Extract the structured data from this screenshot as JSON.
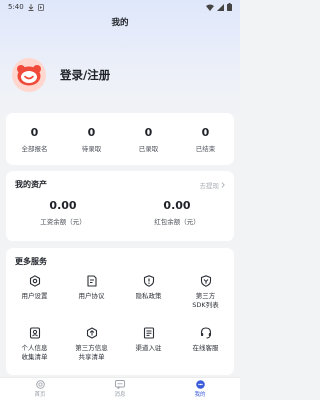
{
  "status_bar": {
    "time": "5:40"
  },
  "nav": {
    "title": "我的"
  },
  "profile": {
    "login_label": "登录/注册"
  },
  "stats": [
    {
      "value": "0",
      "label": "全部报名"
    },
    {
      "value": "0",
      "label": "待录取"
    },
    {
      "value": "0",
      "label": "已录取"
    },
    {
      "value": "0",
      "label": "已结束"
    }
  ],
  "assets": {
    "title": "我的资产",
    "withdraw_label": "去提现",
    "items": [
      {
        "value": "0.00",
        "label": "工资余额（元）"
      },
      {
        "value": "0.00",
        "label": "红包余额（元）"
      }
    ]
  },
  "services": {
    "title": "更多服务",
    "items": [
      {
        "label": "用户设置",
        "icon": "settings-icon"
      },
      {
        "label": "用户协议",
        "icon": "agreement-icon"
      },
      {
        "label": "隐私政策",
        "icon": "privacy-shield-icon"
      },
      {
        "label": "第三方\nSDK列表",
        "icon": "sdk-shield-icon"
      },
      {
        "label": "个人信息\n收集清单",
        "icon": "personal-info-icon"
      },
      {
        "label": "第三方信息\n共享清单",
        "icon": "share-info-icon"
      },
      {
        "label": "渠道入驻",
        "icon": "channel-doc-icon"
      },
      {
        "label": "在线客服",
        "icon": "customer-service-icon"
      }
    ]
  },
  "tabbar": {
    "items": [
      {
        "label": "首页",
        "icon": "home-icon",
        "active": false
      },
      {
        "label": "消息",
        "icon": "message-icon",
        "active": false
      },
      {
        "label": "我的",
        "icon": "profile-icon",
        "active": true
      }
    ]
  },
  "colors": {
    "accent": "#3b5bdb",
    "avatar_bg": "#ffd7cf",
    "avatar_face": "#f04a3a"
  }
}
